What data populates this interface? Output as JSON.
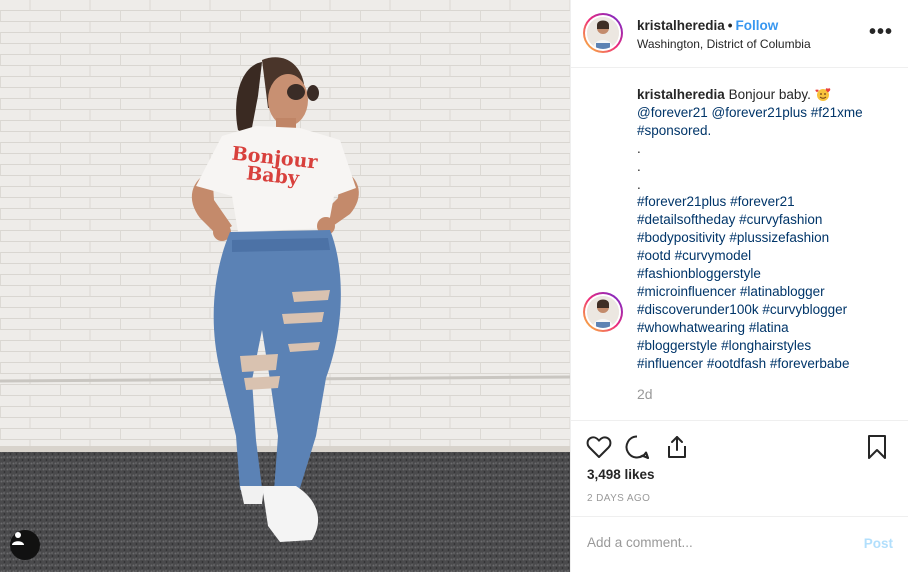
{
  "post": {
    "username": "kristalheredia",
    "dot": "•",
    "follow_label": "Follow",
    "location": "Washington, District of Columbia",
    "more_label": "•••",
    "photo_shirt_text_1": "Bonjour",
    "photo_shirt_text_2": "Baby"
  },
  "caption": {
    "username": "kristalheredia",
    "text": "Bonjour baby.",
    "line2": [
      "@forever21",
      "@forever21plus",
      "#f21xme"
    ],
    "line3": [
      "#sponsored."
    ],
    "dots": [
      ".",
      ".",
      "."
    ],
    "hashtag_lines": [
      [
        "#forever21plus",
        "#forever21"
      ],
      [
        "#detailsoftheday",
        "#curvyfashion"
      ],
      [
        "#bodypositivity",
        "#plussizefashion"
      ],
      [
        "#ootd",
        "#curvymodel"
      ],
      [
        "#fashionbloggerstyle"
      ],
      [
        "#microinfluencer",
        "#latinablogger"
      ],
      [
        "#discoverunder100k",
        "#curvyblogger"
      ],
      [
        "#whowhatwearing",
        "#latina"
      ],
      [
        "#bloggerstyle",
        "#longhairstyles"
      ],
      [
        "#influencer",
        "#ootdfash",
        "#foreverbabe"
      ]
    ],
    "time_ago": "2d"
  },
  "stats": {
    "likes": "3,498 likes",
    "date": "2 DAYS AGO"
  },
  "comment_box": {
    "placeholder": "Add a comment...",
    "post_label": "Post"
  },
  "colors": {
    "link": "#3897f0",
    "hashtag": "#003569",
    "muted": "#999999",
    "post_disabled": "#b2dffc"
  },
  "icons": {
    "like": "heart-icon",
    "comment": "comment-icon",
    "share": "share-icon",
    "save": "bookmark-icon",
    "more": "more-options-icon",
    "user_tag": "user-tag-icon"
  }
}
